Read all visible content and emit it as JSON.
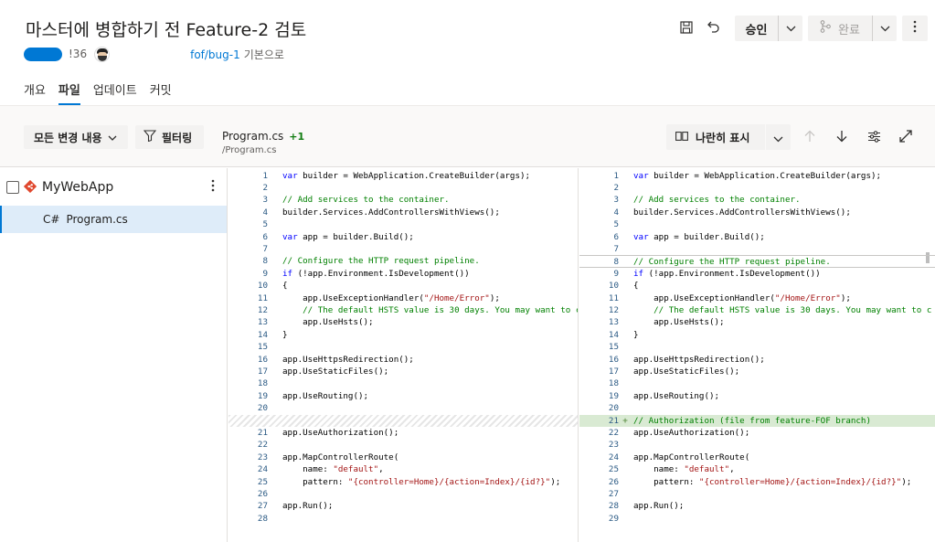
{
  "header": {
    "title": "마스터에 병합하기 전 Feature-2 검토",
    "pr_id": "!36",
    "branch": "fof/bug-1",
    "branch_suffix": "기본으로",
    "approve_label": "승인",
    "complete_label": "완료"
  },
  "tabs": [
    {
      "label": "개요",
      "active": false
    },
    {
      "label": "파일",
      "active": true
    },
    {
      "label": "업데이트",
      "active": false
    },
    {
      "label": "커밋",
      "active": false
    }
  ],
  "toolbar": {
    "all_changes_label": "모든 변경 내용",
    "filter_label": "필터링",
    "file_name": "Program.cs",
    "file_change_count": "+1",
    "file_path": "/Program.cs",
    "view_mode_label": "나란히 표시"
  },
  "tree": {
    "repo_name": "MyWebApp",
    "file_type_icon": "C#",
    "file_name": "Program.cs"
  },
  "colors": {
    "accent": "#0078d4",
    "added_line_bg": "#d9ead3",
    "added_count": "#107c10",
    "keyword": "#0000ff",
    "comment": "#008000",
    "string": "#a31515"
  },
  "diff": {
    "left": [
      {
        "n": "1",
        "parts": [
          [
            "kw",
            "var"
          ],
          [
            "",
            "builder = WebApplication.CreateBuilder(args);"
          ]
        ]
      },
      {
        "n": "2",
        "parts": []
      },
      {
        "n": "3",
        "parts": [
          [
            "cm",
            "// Add services to the container."
          ]
        ]
      },
      {
        "n": "4",
        "parts": [
          [
            "",
            "builder.Services.AddControllersWithViews();"
          ]
        ]
      },
      {
        "n": "5",
        "parts": []
      },
      {
        "n": "6",
        "parts": [
          [
            "kw",
            "var"
          ],
          [
            "",
            "app = builder.Build();"
          ]
        ]
      },
      {
        "n": "7",
        "parts": []
      },
      {
        "n": "8",
        "parts": [
          [
            "cm",
            "// Configure the HTTP request pipeline."
          ]
        ]
      },
      {
        "n": "9",
        "parts": [
          [
            "kw",
            "if"
          ],
          [
            "",
            "(!app.Environment.IsDevelopment())"
          ]
        ]
      },
      {
        "n": "10",
        "parts": [
          [
            "",
            "{"
          ]
        ]
      },
      {
        "n": "11",
        "parts": [
          [
            "",
            "    app.UseExceptionHandler("
          ],
          [
            "st",
            "\"/Home/Error\""
          ],
          [
            "",
            ");"
          ]
        ]
      },
      {
        "n": "12",
        "parts": [
          [
            "cm",
            "    // The default HSTS value is 30 days. You may want to c"
          ]
        ]
      },
      {
        "n": "13",
        "parts": [
          [
            "",
            "    app.UseHsts();"
          ]
        ]
      },
      {
        "n": "14",
        "parts": [
          [
            "",
            "}"
          ]
        ]
      },
      {
        "n": "15",
        "parts": []
      },
      {
        "n": "16",
        "parts": [
          [
            "",
            "app.UseHttpsRedirection();"
          ]
        ]
      },
      {
        "n": "17",
        "parts": [
          [
            "",
            "app.UseStaticFiles();"
          ]
        ]
      },
      {
        "n": "18",
        "parts": []
      },
      {
        "n": "19",
        "parts": [
          [
            "",
            "app.UseRouting();"
          ]
        ]
      },
      {
        "n": "20",
        "parts": []
      },
      {
        "n": "",
        "kind": "hatched",
        "parts": []
      },
      {
        "n": "21",
        "parts": [
          [
            "",
            "app.UseAuthorization();"
          ]
        ]
      },
      {
        "n": "22",
        "parts": []
      },
      {
        "n": "23",
        "parts": [
          [
            "",
            "app.MapControllerRoute("
          ]
        ]
      },
      {
        "n": "24",
        "parts": [
          [
            "",
            "    name: "
          ],
          [
            "st",
            "\"default\""
          ],
          [
            "",
            ","
          ]
        ]
      },
      {
        "n": "25",
        "parts": [
          [
            "",
            "    pattern: "
          ],
          [
            "st",
            "\"{controller=Home}/{action=Index}/{id?}\""
          ],
          [
            "",
            ");"
          ]
        ]
      },
      {
        "n": "26",
        "parts": []
      },
      {
        "n": "27",
        "parts": [
          [
            "",
            "app.Run();"
          ]
        ]
      },
      {
        "n": "28",
        "parts": []
      }
    ],
    "right": [
      {
        "n": "1",
        "parts": [
          [
            "kw",
            "var"
          ],
          [
            "",
            "builder = WebApplication.CreateBuilder(args);"
          ]
        ]
      },
      {
        "n": "2",
        "parts": []
      },
      {
        "n": "3",
        "parts": [
          [
            "cm",
            "// Add services to the container."
          ]
        ]
      },
      {
        "n": "4",
        "parts": [
          [
            "",
            "builder.Services.AddControllersWithViews();"
          ]
        ]
      },
      {
        "n": "5",
        "parts": []
      },
      {
        "n": "6",
        "parts": [
          [
            "kw",
            "var"
          ],
          [
            "",
            "app = builder.Build();"
          ]
        ]
      },
      {
        "n": "7",
        "parts": []
      },
      {
        "n": "8",
        "kind": "cursor",
        "parts": [
          [
            "cm",
            "// Configure the HTTP request pipeline."
          ]
        ]
      },
      {
        "n": "9",
        "parts": [
          [
            "kw",
            "if"
          ],
          [
            "",
            "(!app.Environment.IsDevelopment())"
          ]
        ]
      },
      {
        "n": "10",
        "parts": [
          [
            "",
            "{"
          ]
        ]
      },
      {
        "n": "11",
        "parts": [
          [
            "",
            "    app.UseExceptionHandler("
          ],
          [
            "st",
            "\"/Home/Error\""
          ],
          [
            "",
            ");"
          ]
        ]
      },
      {
        "n": "12",
        "parts": [
          [
            "cm",
            "    // The default HSTS value is 30 days. You may want to c"
          ]
        ]
      },
      {
        "n": "13",
        "parts": [
          [
            "",
            "    app.UseHsts();"
          ]
        ]
      },
      {
        "n": "14",
        "parts": [
          [
            "",
            "}"
          ]
        ]
      },
      {
        "n": "15",
        "parts": []
      },
      {
        "n": "16",
        "parts": [
          [
            "",
            "app.UseHttpsRedirection();"
          ]
        ]
      },
      {
        "n": "17",
        "parts": [
          [
            "",
            "app.UseStaticFiles();"
          ]
        ]
      },
      {
        "n": "18",
        "parts": []
      },
      {
        "n": "19",
        "parts": [
          [
            "",
            "app.UseRouting();"
          ]
        ]
      },
      {
        "n": "20",
        "parts": []
      },
      {
        "n": "21",
        "kind": "added",
        "marker": "+",
        "parts": [
          [
            "cm",
            "// Authorization (file from feature-FOF branch)"
          ]
        ]
      },
      {
        "n": "22",
        "parts": [
          [
            "",
            "app.UseAuthorization();"
          ]
        ]
      },
      {
        "n": "23",
        "parts": []
      },
      {
        "n": "24",
        "parts": [
          [
            "",
            "app.MapControllerRoute("
          ]
        ]
      },
      {
        "n": "25",
        "parts": [
          [
            "",
            "    name: "
          ],
          [
            "st",
            "\"default\""
          ],
          [
            "",
            ","
          ]
        ]
      },
      {
        "n": "26",
        "parts": [
          [
            "",
            "    pattern: "
          ],
          [
            "st",
            "\"{controller=Home}/{action=Index}/{id?}\""
          ],
          [
            "",
            ");"
          ]
        ]
      },
      {
        "n": "27",
        "parts": []
      },
      {
        "n": "28",
        "parts": [
          [
            "",
            "app.Run();"
          ]
        ]
      },
      {
        "n": "29",
        "parts": []
      }
    ]
  }
}
